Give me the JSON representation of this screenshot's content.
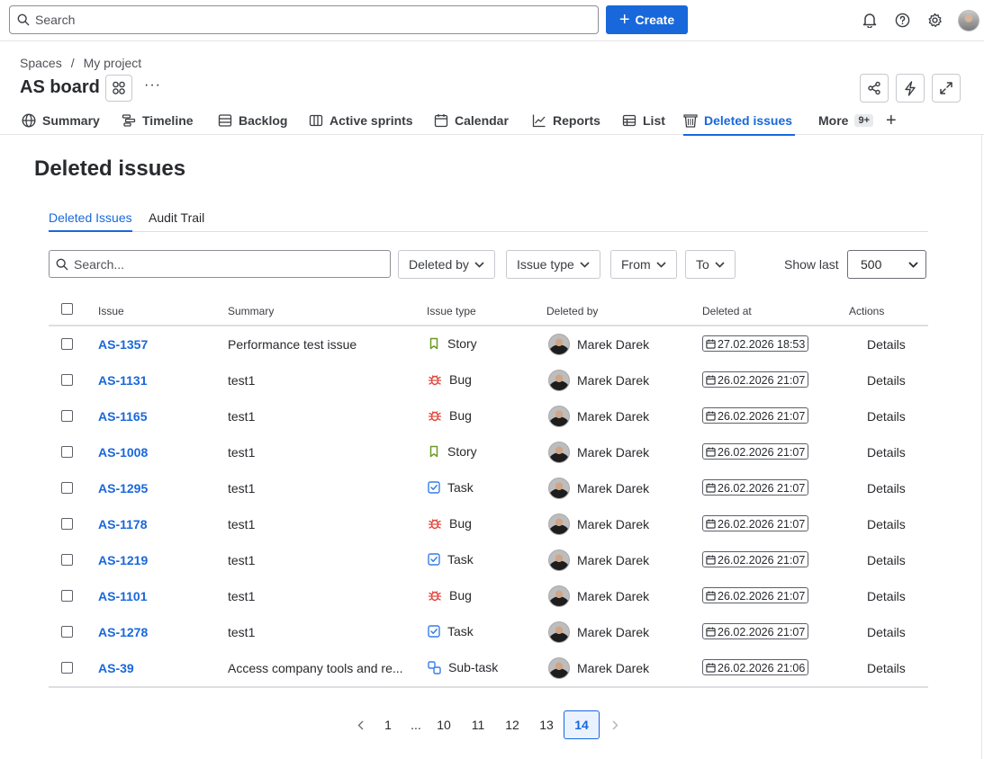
{
  "topbar": {
    "search_placeholder": "Search",
    "create_label": "Create"
  },
  "header": {
    "breadcrumb": [
      "Spaces",
      "/",
      "My project"
    ],
    "title": "AS board",
    "more": "···"
  },
  "nav": {
    "tabs": [
      {
        "label": "Summary",
        "icon": "globe-icon"
      },
      {
        "label": "Timeline",
        "icon": "timeline-icon"
      },
      {
        "label": "Backlog",
        "icon": "backlog-icon"
      },
      {
        "label": "Active sprints",
        "icon": "board-icon"
      },
      {
        "label": "Calendar",
        "icon": "calendar-icon"
      },
      {
        "label": "Reports",
        "icon": "reports-icon"
      },
      {
        "label": "List",
        "icon": "list-icon"
      },
      {
        "label": "Deleted issues",
        "icon": "trash-icon",
        "active": true
      },
      {
        "label": "More",
        "icon": "",
        "badge": "9+"
      }
    ]
  },
  "page": {
    "title": "Deleted issues",
    "subtabs": [
      "Deleted Issues",
      "Audit Trail"
    ],
    "search_placeholder": "Search...",
    "filters": [
      "Deleted by",
      "Issue type",
      "From",
      "To"
    ],
    "show_last_label": "Show last",
    "show_last_value": "500"
  },
  "table": {
    "headers": [
      "Issue",
      "Summary",
      "Issue type",
      "Deleted by",
      "Deleted at",
      "Actions"
    ],
    "rows": [
      {
        "issue": "AS-1357",
        "summary": "Performance test issue",
        "type": "Story",
        "user": "Marek Darek",
        "date": "27.02.2026 18:53",
        "action": "Details"
      },
      {
        "issue": "AS-1131",
        "summary": "test1",
        "type": "Bug",
        "user": "Marek Darek",
        "date": "26.02.2026 21:07",
        "action": "Details"
      },
      {
        "issue": "AS-1165",
        "summary": "test1",
        "type": "Bug",
        "user": "Marek Darek",
        "date": "26.02.2026 21:07",
        "action": "Details"
      },
      {
        "issue": "AS-1008",
        "summary": "test1",
        "type": "Story",
        "user": "Marek Darek",
        "date": "26.02.2026 21:07",
        "action": "Details"
      },
      {
        "issue": "AS-1295",
        "summary": "test1",
        "type": "Task",
        "user": "Marek Darek",
        "date": "26.02.2026 21:07",
        "action": "Details"
      },
      {
        "issue": "AS-1178",
        "summary": "test1",
        "type": "Bug",
        "user": "Marek Darek",
        "date": "26.02.2026 21:07",
        "action": "Details"
      },
      {
        "issue": "AS-1219",
        "summary": "test1",
        "type": "Task",
        "user": "Marek Darek",
        "date": "26.02.2026 21:07",
        "action": "Details"
      },
      {
        "issue": "AS-1101",
        "summary": "test1",
        "type": "Bug",
        "user": "Marek Darek",
        "date": "26.02.2026 21:07",
        "action": "Details"
      },
      {
        "issue": "AS-1278",
        "summary": "test1",
        "type": "Task",
        "user": "Marek Darek",
        "date": "26.02.2026 21:07",
        "action": "Details"
      },
      {
        "issue": "AS-39",
        "summary": "Access company tools and re...",
        "type": "Sub-task",
        "user": "Marek Darek",
        "date": "26.02.2026 21:06",
        "action": "Details"
      }
    ]
  },
  "pagination": {
    "pages": [
      "1",
      "...",
      "10",
      "11",
      "12",
      "13",
      "14"
    ],
    "current": "14"
  },
  "colors": {
    "accent": "#1868db",
    "bug": "#e2483d",
    "story": "#6a9a23",
    "task": "#357de8",
    "subtask": "#357de8"
  }
}
